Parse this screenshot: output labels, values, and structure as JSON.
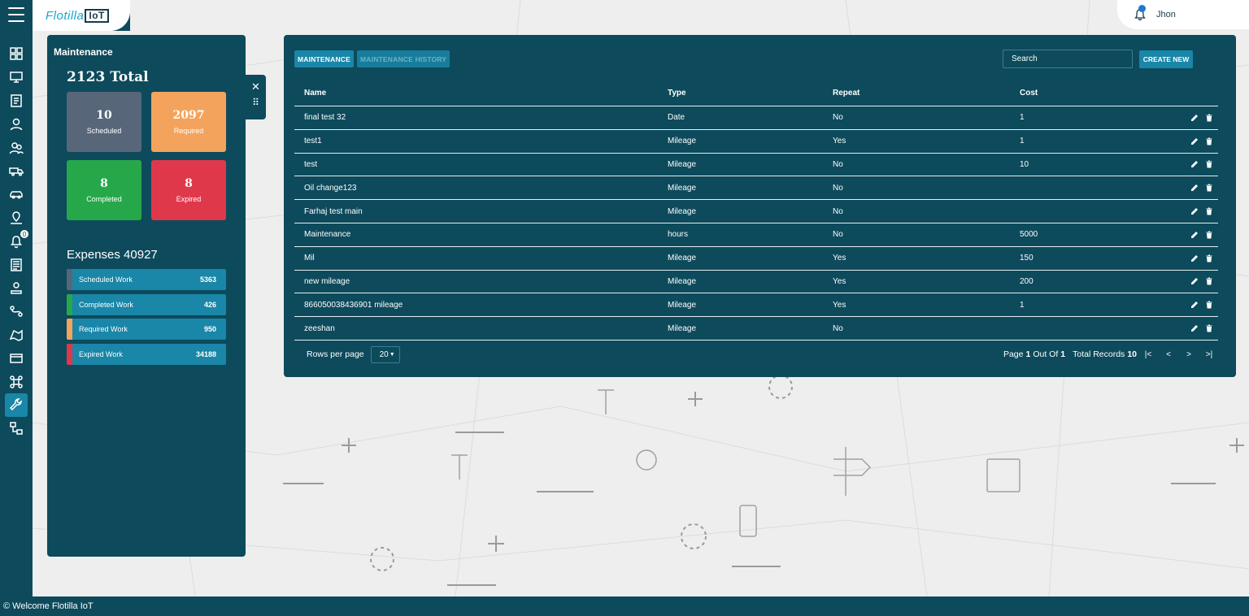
{
  "brand": {
    "logo_text": "Flotilla",
    "logo_box": "IoT"
  },
  "user": {
    "name": "Jhon"
  },
  "sidebar": {
    "items": [
      {
        "icon": "dashboard-icon",
        "notification": ""
      },
      {
        "icon": "monitor-icon",
        "notification": ""
      },
      {
        "icon": "report-icon",
        "notification": ""
      },
      {
        "icon": "user-icon",
        "notification": ""
      },
      {
        "icon": "users-icon",
        "notification": ""
      },
      {
        "icon": "truck-icon",
        "notification": ""
      },
      {
        "icon": "car-icon",
        "notification": ""
      },
      {
        "icon": "location-icon",
        "notification": ""
      },
      {
        "icon": "alert-bell-icon",
        "notification": "0"
      },
      {
        "icon": "document-icon",
        "notification": ""
      },
      {
        "icon": "driver-icon",
        "notification": ""
      },
      {
        "icon": "route-icon",
        "notification": ""
      },
      {
        "icon": "geofence-icon",
        "notification": ""
      },
      {
        "icon": "card-icon",
        "notification": ""
      },
      {
        "icon": "command-icon",
        "notification": ""
      },
      {
        "icon": "wrench-icon",
        "notification": ""
      },
      {
        "icon": "workflow-icon",
        "notification": ""
      }
    ]
  },
  "summary": {
    "title": "Maintenance",
    "total": "2123 Total",
    "tiles": {
      "scheduled": {
        "count": "10",
        "label": "Scheduled"
      },
      "required": {
        "count": "2097",
        "label": "Required"
      },
      "completed": {
        "count": "8",
        "label": "Completed"
      },
      "expired": {
        "count": "8",
        "label": "Expired"
      }
    },
    "expenses_title": "Expenses 40927",
    "expenses": [
      {
        "label": "Scheduled Work",
        "value": "5363",
        "color": "#58667a"
      },
      {
        "label": "Completed Work",
        "value": "426",
        "color": "#26a84a"
      },
      {
        "label": "Required Work",
        "value": "950",
        "color": "#f3a35c"
      },
      {
        "label": "Expired Work",
        "value": "34188",
        "color": "#e0384b"
      }
    ]
  },
  "main": {
    "tabs": [
      "MAINTENANCE",
      "MAINTENANCE HISTORY"
    ],
    "search_placeholder": "Search",
    "create_label": "CREATE NEW",
    "columns": [
      "Name",
      "Type",
      "Repeat",
      "Cost"
    ],
    "rows": [
      {
        "name": "final test 32",
        "type": "Date",
        "repeat": "No",
        "cost": "1"
      },
      {
        "name": "test1",
        "type": "Mileage",
        "repeat": "Yes",
        "cost": "1"
      },
      {
        "name": "test",
        "type": "Mileage",
        "repeat": "No",
        "cost": "10"
      },
      {
        "name": "Oil change123",
        "type": "Mileage",
        "repeat": "No",
        "cost": ""
      },
      {
        "name": "Farhaj test main",
        "type": "Mileage",
        "repeat": "No",
        "cost": ""
      },
      {
        "name": "Maintenance",
        "type": "hours",
        "repeat": "No",
        "cost": "5000"
      },
      {
        "name": "Mil",
        "type": "Mileage",
        "repeat": "Yes",
        "cost": "150"
      },
      {
        "name": "new mileage",
        "type": "Mileage",
        "repeat": "Yes",
        "cost": "200"
      },
      {
        "name": "866050038436901 mileage",
        "type": "Mileage",
        "repeat": "Yes",
        "cost": "1"
      },
      {
        "name": "zeeshan",
        "type": "Mileage",
        "repeat": "No",
        "cost": ""
      }
    ],
    "pager": {
      "rows_per_page_label": "Rows per page",
      "rows_per_page": "20",
      "page_label": "Page",
      "page": "1",
      "out_of_label": "Out Of",
      "pages": "1",
      "total_label": "Total Records",
      "total": "10"
    }
  },
  "footer": {
    "text": "© Welcome Flotilla IoT"
  },
  "colors": {
    "panel": "#0d4a5c",
    "accent": "#1a86a8",
    "scheduled": "#58667a",
    "required": "#f3a35c",
    "completed": "#26a84a",
    "expired": "#e0384b"
  }
}
